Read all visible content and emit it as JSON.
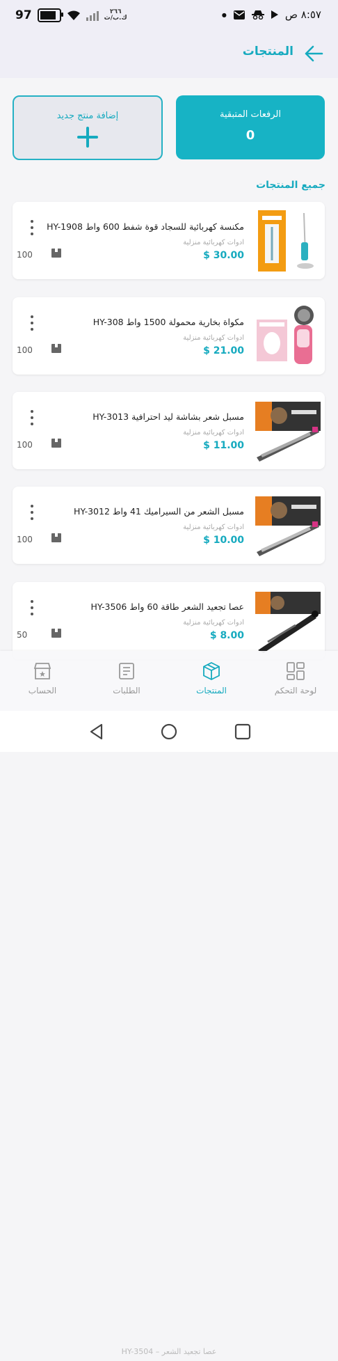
{
  "status": {
    "battery": "97",
    "carrier": "٢٦٦\nك.ب/ث",
    "time": "٨:٥٧ ص"
  },
  "header": {
    "title": "المنتجات"
  },
  "stats": {
    "remaining_label": "الرفعات المتبقية",
    "remaining_value": "0",
    "add_label": "إضافة منتج جديد"
  },
  "section_title": "جميع المنتجات",
  "products": [
    {
      "name": "مكنسة كهربائية للسجاد قوة شفط 600 واط HY-1908",
      "category": "ادوات كهربائية منزلية",
      "price": "$ 30.00",
      "stock": "100"
    },
    {
      "name": "مكواة بخارية محمولة 1500 واط HY-308",
      "category": "ادوات كهربائية منزلية",
      "price": "$ 21.00",
      "stock": "100"
    },
    {
      "name": "مسبل شعر بشاشة ليد احترافية  HY-3013",
      "category": "ادوات كهربائية منزلية",
      "price": "$ 11.00",
      "stock": "100"
    },
    {
      "name": "مسبل الشعر من السيراميك 41 واط HY-3012",
      "category": "ادوات كهربائية منزلية",
      "price": "$ 10.00",
      "stock": "100"
    },
    {
      "name": "عصا تجعيد الشعر طاقة 60 واط HY-3506",
      "category": "ادوات كهربائية منزلية",
      "price": "$ 8.00",
      "stock": "50"
    }
  ],
  "peek_text": "عصا تجعيد الشعر – HY-3504",
  "nav": {
    "dashboard": "لوحة التحكم",
    "products": "المنتجات",
    "orders": "الطلبات",
    "account": "الحساب"
  },
  "colors": {
    "accent": "#16aabf",
    "header_bg": "#efeef6"
  },
  "icons": [
    "back-arrow-icon",
    "plus-icon",
    "kebab-menu-icon",
    "box-icon",
    "grid-icon",
    "package-icon",
    "receipt-icon",
    "store-icon"
  ]
}
